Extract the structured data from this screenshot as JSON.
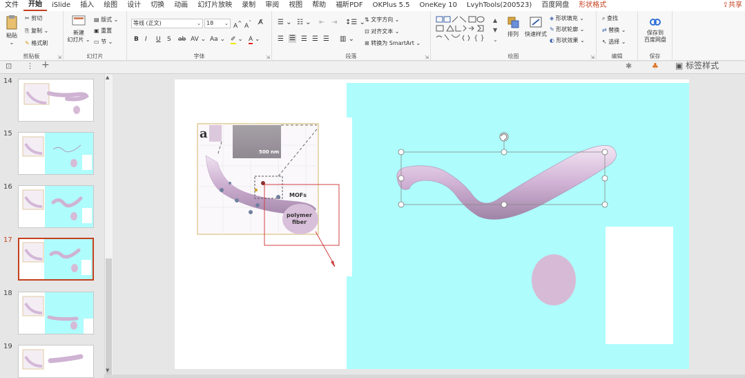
{
  "menu": {
    "tabs": [
      "文件",
      "开始",
      "iSlide",
      "插入",
      "绘图",
      "设计",
      "切换",
      "动画",
      "幻灯片放映",
      "录制",
      "审阅",
      "视图",
      "帮助",
      "福昕PDF",
      "OKPlus 5.5",
      "OneKey 10",
      "LvyhTools(200523)",
      "百度网盘",
      "形状格式"
    ],
    "active_tab": "开始",
    "contextual_tab": "形状格式",
    "share": "共享"
  },
  "ribbon": {
    "clipboard": {
      "paste": "粘贴",
      "cut": "剪切",
      "copy": "复制",
      "format_painter": "格式刷",
      "label": "剪贴板"
    },
    "slides": {
      "new_slide": "新建",
      "new_slide2": "幻灯片",
      "layout": "版式",
      "reset": "重置",
      "section": "节",
      "label": "幻灯片"
    },
    "font": {
      "font_name": "等线 (正文)",
      "font_size": "18",
      "label": "字体"
    },
    "paragraph": {
      "text_direction": "文字方向",
      "align_text": "对齐文本",
      "smartart": "转换为 SmartArt",
      "label": "段落"
    },
    "drawing": {
      "arrange": "排列",
      "quick_styles": "快速样式",
      "fill": "形状填充",
      "outline": "形状轮廓",
      "effects": "形状效果",
      "label": "绘图"
    },
    "editing": {
      "find": "查找",
      "replace": "替换",
      "select": "选择",
      "label": "编辑"
    },
    "save": {
      "save_to": "保存到",
      "baidu": "百度网盘",
      "label": "保存"
    }
  },
  "quickbar": {
    "right_label": "标签样式"
  },
  "slides": {
    "numbers": [
      "14",
      "15",
      "16",
      "17",
      "18",
      "19"
    ],
    "selected": "17"
  },
  "slide": {
    "figure_letter": "a",
    "scale_label": "500 nm",
    "mofs_label": "MOFs",
    "fiber_label_1": "polymer",
    "fiber_label_2": "fiber"
  },
  "colors": {
    "accent": "#c43e1c",
    "cyan": "#aefcfc",
    "tube": "#d9c0da",
    "ellipse": "#d7bbd6",
    "callout_red": "#d04040"
  }
}
